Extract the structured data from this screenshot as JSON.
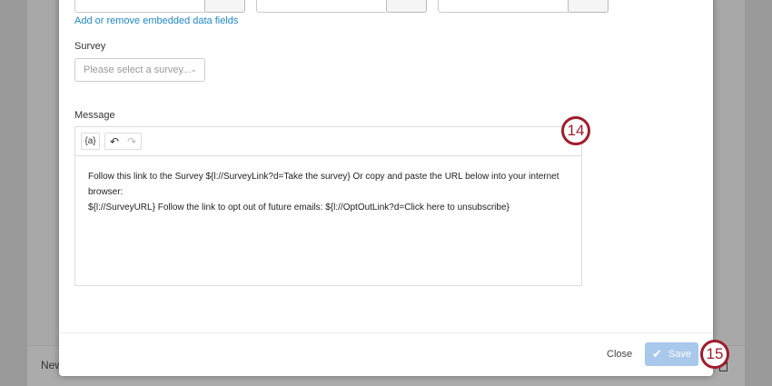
{
  "background": {
    "row_label": "New"
  },
  "embedded": {
    "link": "Add or remove embedded data fields"
  },
  "survey": {
    "label": "Survey",
    "placeholder": "Please select a survey..."
  },
  "message": {
    "label": "Message",
    "piped_text_button": "{a}",
    "body_line1": "Follow this link to the Survey ${l://SurveyLink?d=Take the survey} Or copy and paste the URL below into your internet browser:",
    "body_line2": "${l://SurveyURL} Follow the link to opt out of future emails: ${l://OptOutLink?d=Click here to unsubscribe}"
  },
  "footer": {
    "close": "Close",
    "save": "Save"
  },
  "callouts": {
    "c14": "14",
    "c15": "15"
  },
  "colors": {
    "accent": "#1e88c9",
    "callout": "#a01c2c",
    "save_disabled": "#a8c8ec"
  }
}
